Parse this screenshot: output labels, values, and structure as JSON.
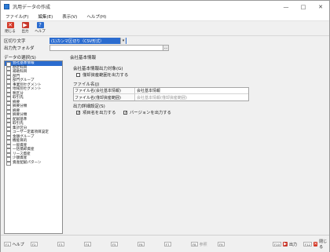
{
  "window": {
    "title": "汎用データの作成",
    "controls": [
      "—",
      "□",
      "✕"
    ]
  },
  "menu": [
    "ファイル(F)",
    "編集(E)",
    "表示(V)",
    "ヘルプ(H)"
  ],
  "toolbar": [
    {
      "label": "閉じる",
      "icon": "close-icon",
      "color": "#d43b2a",
      "glyph": "✕"
    },
    {
      "label": "出力",
      "icon": "output-icon",
      "color": "#c8372b",
      "glyph": "▶"
    },
    {
      "label": "ヘルプ",
      "icon": "help-icon",
      "color": "#2b6ccf",
      "glyph": "?"
    }
  ],
  "form": {
    "delimiter_label": "区切り文字",
    "delimiter_value": "(1)カンマ区切り（CSV形式）",
    "folder_label": "出力先フォルダ",
    "folder_value": "",
    "folder_button": "…"
  },
  "data_list": {
    "title": "データの選択(S)",
    "items": [
      "会社基本情報",
      "勘定科目",
      "補助科目",
      "部門",
      "部門グループ",
      "事業別セグメント",
      "地域別セグメント",
      "税区分",
      "取引先",
      "摘要",
      "摘要分類",
      "摘要",
      "摘要分類",
      "配賦基準",
      "取引先",
      "集計区分",
      "ユーザー定義項目設定",
      "金額グループ",
      "機能目的",
      "一般資産",
      "一括償却資産",
      "リース資産",
      "少額資産",
      "資産配賦パターン"
    ],
    "selected_index": 0
  },
  "panel": {
    "title": "会社基本情報",
    "output_target_label": "会社基本情報出力対象(G)",
    "output_target_checkbox": "僅却資産範囲を出力する",
    "output_target_checked": false,
    "filename_label": "ファイル名(J)",
    "files": [
      {
        "label": "ファイル名(会社基本情報)",
        "value": "会社基本情報",
        "dim": false
      },
      {
        "label": "ファイル名(僅却資産範囲)",
        "value": "会社基本情報(僅却資産範囲)",
        "dim": true
      }
    ],
    "detail_label": "出力詳細設定(S)",
    "detail_options": [
      {
        "label": "項目名を出力する",
        "checked": true
      },
      {
        "label": "バージョンを出力する",
        "checked": true
      }
    ]
  },
  "footer": {
    "keys": [
      {
        "tag": "F1",
        "label": "ヘルプ",
        "dim": false
      },
      {
        "tag": "F2",
        "label": "",
        "dim": true
      },
      {
        "tag": "F3",
        "label": "",
        "dim": true
      },
      {
        "tag": "F4",
        "label": "",
        "dim": true
      },
      {
        "tag": "F5",
        "label": "",
        "dim": true
      },
      {
        "tag": "F6",
        "label": "",
        "dim": true
      },
      {
        "tag": "F7",
        "label": "",
        "dim": true
      },
      {
        "tag": "F8",
        "label": "参照",
        "dim": true
      },
      {
        "tag": "F9",
        "label": "",
        "dim": true
      },
      {
        "tag": "F10",
        "label": "出力",
        "dim": false
      },
      {
        "tag": "F12",
        "label": "閉じる",
        "dim": false
      }
    ]
  }
}
